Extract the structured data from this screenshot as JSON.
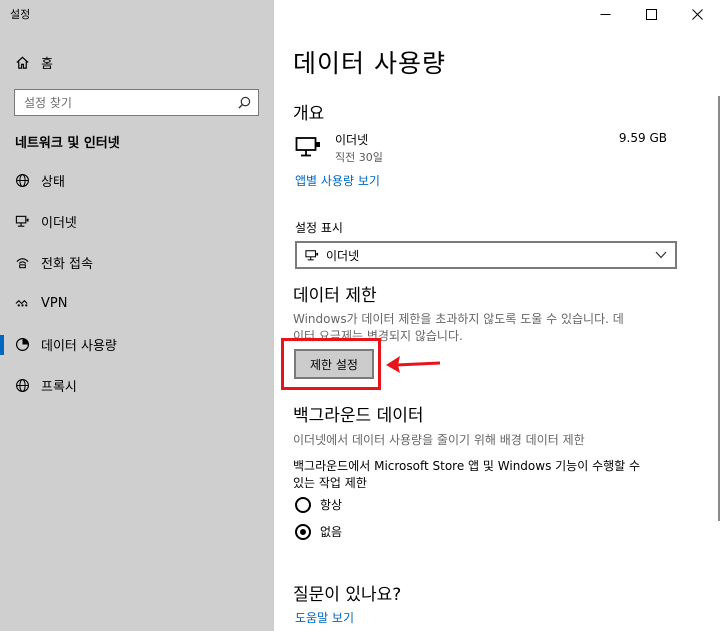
{
  "window": {
    "title": "설정"
  },
  "sidebar": {
    "home": "홈",
    "search_placeholder": "설정 찾기",
    "section_title": "네트워크 및 인터넷",
    "items": [
      {
        "label": "상태",
        "icon": "globe-icon"
      },
      {
        "label": "이더넷",
        "icon": "monitor-icon"
      },
      {
        "label": "전화 접속",
        "icon": "phone-icon"
      },
      {
        "label": "VPN",
        "icon": "vpn-icon"
      },
      {
        "label": "데이터 사용량",
        "icon": "data-usage-icon",
        "active": true
      },
      {
        "label": "프록시",
        "icon": "globe-icon"
      }
    ]
  },
  "main": {
    "title": "데이터 사용량",
    "overview": {
      "heading": "개요",
      "network_name": "이더넷",
      "network_period": "직전 30일",
      "usage": "9.59 GB",
      "app_usage_link": "앱별 사용량 보기"
    },
    "settings_display": {
      "label": "설정 표시",
      "selected": "이더넷"
    },
    "data_limit": {
      "heading": "데이터 제한",
      "desc_line1": "Windows가 데이터 제한을 초과하지 않도록 도울 수 있습니다. 데",
      "desc_line2": "이터 요금제는 변경되지 않습니다.",
      "button": "제한 설정"
    },
    "background_data": {
      "heading": "백그라운드 데이터",
      "desc": "이더넷에서 데이터 사용량을 줄이기 위해 배경 데이터 제한",
      "question_line1": "백그라운드에서 Microsoft Store 앱 및 Windows 기능이 수행할 수",
      "question_line2": "있는 작업 제한",
      "options": [
        {
          "label": "항상",
          "checked": false
        },
        {
          "label": "없음",
          "checked": true
        }
      ]
    },
    "help": {
      "heading": "질문이 있나요?",
      "link": "도움말 보기"
    }
  },
  "colors": {
    "accent": "#0067c0",
    "sidebar_bg": "#cfcfcf",
    "highlight": "#e8141c"
  }
}
